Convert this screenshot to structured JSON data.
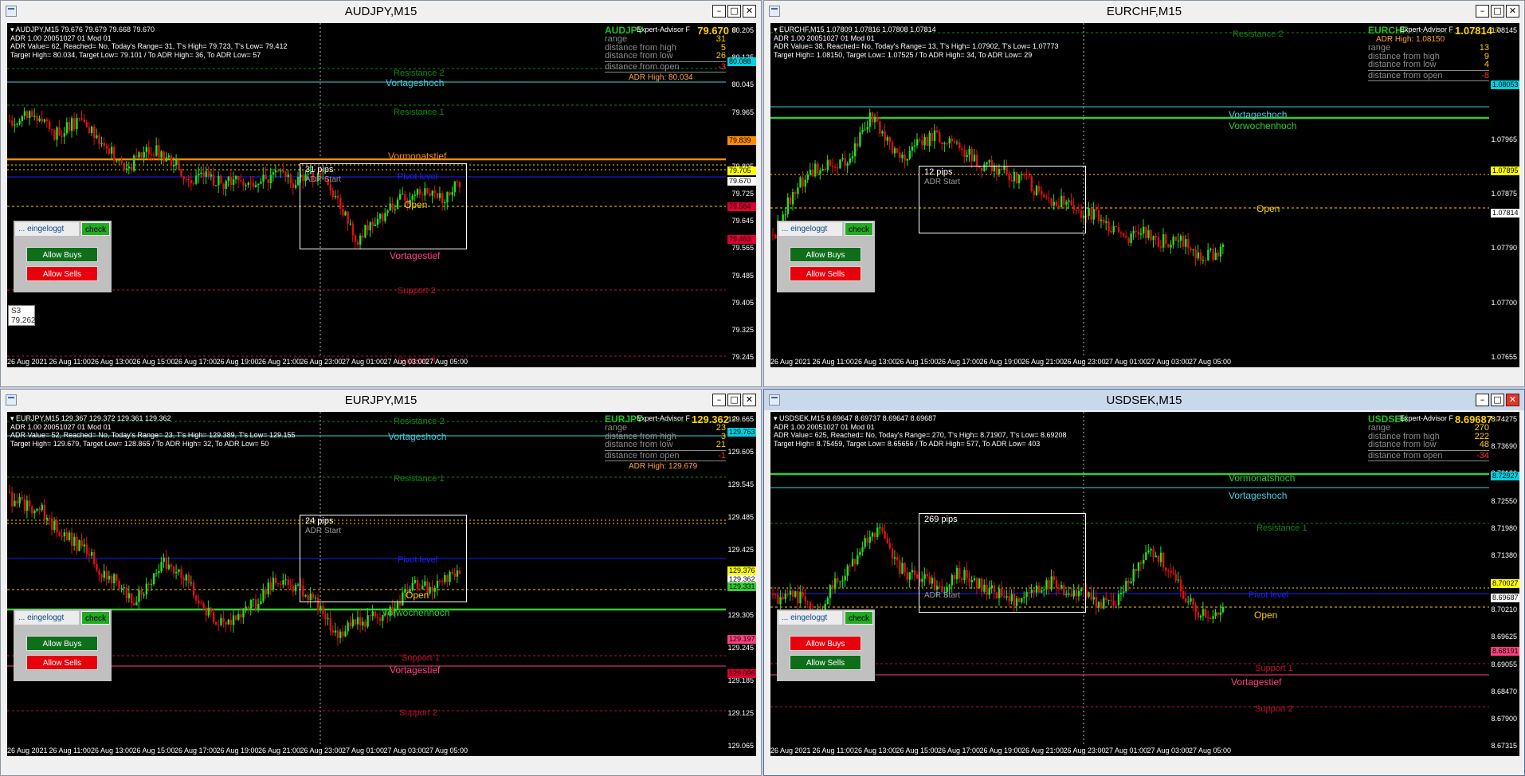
{
  "tooltip": {
    "line1": "S3",
    "line2": "79.262"
  },
  "common": {
    "adr_line": "ADR 1.00 20051027 01 Mod 01",
    "ea_label": "Expert-Advisor F",
    "adr_start": "ADR Start",
    "login": "... eingeloggt",
    "check": "check",
    "allow_buys": "Allow Buys",
    "allow_sells": "Allow Sells",
    "xticks": [
      "26 Aug 2021",
      "26 Aug 11:00",
      "26 Aug 13:00",
      "26 Aug 15:00",
      "26 Aug 17:00",
      "26 Aug 19:00",
      "26 Aug 21:00",
      "26 Aug 23:00",
      "27 Aug 01:00",
      "27 Aug 03:00",
      "27 Aug 05:00"
    ],
    "labels": {
      "range": "range",
      "dist_high": "distance from high",
      "dist_low": "distance from low",
      "dist_open": "distance from open"
    }
  },
  "windows": [
    {
      "title": "AUDJPY,M15",
      "symbol_line": "AUDJPY,M15  79.676 79.679 79.668 79.670",
      "adr_value_line": "ADR Value= 62, Reached= No, Today's Range= 31, T's High= 79.723, T's Low= 79.412",
      "target_line": "Target High= 80.034, Target Low= 79.101 / To ADR High= 36, To ADR Low= 57",
      "symbol": "AUDJPY",
      "price": "79.670",
      "panel": {
        "range": "31",
        "dist_high": "5",
        "dist_low": "26",
        "dist_open": "-3",
        "adr_line": "ADR High: 80.034"
      },
      "pips": "31 pips",
      "yticks": [
        "80.205",
        "80.125",
        "80.045",
        "79.965",
        "79.885",
        "79.805",
        "79.725",
        "79.645",
        "79.565",
        "79.485",
        "79.405",
        "79.325",
        "79.245"
      ],
      "price_labels": [
        {
          "text": "80.088",
          "color": "#00d0e0"
        },
        {
          "text": "79.839",
          "color": "#ff8c00"
        },
        {
          "text": "79.705",
          "color": "#ffff00"
        },
        {
          "text": "79.670",
          "color": "#ffffff"
        },
        {
          "text": "79.564",
          "color": "#e00030"
        },
        {
          "text": "79.463",
          "color": "#e00030"
        }
      ],
      "levels": [
        {
          "text": "Resistance 2",
          "color": "#118811"
        },
        {
          "text": "Vortageshoch",
          "color": "#40d0e0"
        },
        {
          "text": "Resistance 1",
          "color": "#118811"
        },
        {
          "text": "Vormonatstief",
          "color": "#ff8c00"
        },
        {
          "text": "Pivot level",
          "color": "#2020ff"
        },
        {
          "text": "Open",
          "color": "#ffd000"
        },
        {
          "text": "Vortagestief",
          "color": "#ff4080"
        },
        {
          "text": "Support 2",
          "color": "#c01030"
        },
        {
          "text": "Support 3",
          "color": "#c01030"
        }
      ]
    },
    {
      "title": "EURCHF,M15",
      "symbol_line": "EURCHF,M15  1.07809 1.07816 1.07808 1.07814",
      "adr_value_line": "ADR Value= 38, Reached= No, Today's Range= 13, T's High= 1.07902, T's Low= 1.07773",
      "target_line": "Target High= 1.08150, Target Low= 1.07525 / To ADR High= 34, To ADR Low= 29",
      "symbol": "EURCHF",
      "price": "1.07814",
      "panel": {
        "range": "13",
        "dist_high": "9",
        "dist_low": "4",
        "dist_open": "-8",
        "adr_line": "ADR High: 1.08150"
      },
      "pips": "12 pips",
      "yticks": [
        "1.08145",
        "1.08055",
        "1.07965",
        "1.07875",
        "1.07790",
        "1.07700",
        "1.07655"
      ],
      "price_labels": [
        {
          "text": "1.08053",
          "color": "#00d0e0"
        },
        {
          "text": "1.07895",
          "color": "#ffff00"
        },
        {
          "text": "1.07814",
          "color": "#ffffff"
        }
      ],
      "levels": [
        {
          "text": "Resistance 2",
          "color": "#118811"
        },
        {
          "text": "Vortageshoch",
          "color": "#40d0e0"
        },
        {
          "text": "Vorwochenhoch",
          "color": "#33cc33"
        },
        {
          "text": "Open",
          "color": "#ffd000"
        }
      ]
    },
    {
      "title": "EURJPY,M15",
      "symbol_line": "EURJPY,M15  129.367 129.372 129.361 129.362",
      "adr_value_line": "ADR Value= 52, Reached= No, Today's Range= 23, T's High= 129.389, T's Low= 129.155",
      "target_line": "Target High= 129.679, Target Low= 128.865 / To ADR High= 32, To ADR Low= 50",
      "symbol": "EURJPY",
      "price": "129.362",
      "panel": {
        "range": "23",
        "dist_high": "3",
        "dist_low": "21",
        "dist_open": "-1",
        "adr_line": "ADR High: 129.679"
      },
      "pips": "24 pips",
      "yticks": [
        "129.665",
        "129.605",
        "129.545",
        "129.485",
        "129.425",
        "129.365",
        "129.305",
        "129.245",
        "129.185",
        "129.125",
        "129.065"
      ],
      "price_labels": [
        {
          "text": "129.763",
          "color": "#00d0e0"
        },
        {
          "text": "129.376",
          "color": "#ffff00"
        },
        {
          "text": "129.362",
          "color": "#ffffff"
        },
        {
          "text": "129.331",
          "color": "#33cc33"
        },
        {
          "text": "129.197",
          "color": "#ff4080"
        },
        {
          "text": "129.096",
          "color": "#e00030"
        }
      ],
      "levels": [
        {
          "text": "Resistance 2",
          "color": "#118811"
        },
        {
          "text": "Vortageshoch",
          "color": "#40d0e0"
        },
        {
          "text": "Resistance 1",
          "color": "#118811"
        },
        {
          "text": "Pivot level",
          "color": "#2020ff"
        },
        {
          "text": "Open",
          "color": "#ffd000"
        },
        {
          "text": "Vorwochenhoch",
          "color": "#33cc33"
        },
        {
          "text": "Support 1",
          "color": "#c01030"
        },
        {
          "text": "Vortagestief",
          "color": "#ff4080"
        },
        {
          "text": "Support 2",
          "color": "#c01030"
        }
      ]
    },
    {
      "title": "USDSEK,M15",
      "symbol_line": "USDSEK,M15  8.69647 8.69737 8.69647 8.69687",
      "adr_value_line": "ADR Value= 625, Reached= No, Today's Range= 270, T's High= 8.71907, T's Low= 8.69208",
      "target_line": "Target High= 8.75459, Target Low= 8.65656 / To ADR High= 577, To ADR Low= 403",
      "symbol": "USDSEK",
      "price": "8.69687",
      "panel": {
        "range": "270",
        "dist_high": "222",
        "dist_low": "48",
        "dist_open": "-34",
        "adr_line": ""
      },
      "pips": "269 pips",
      "yticks": [
        "8.74275",
        "8.73690",
        "8.73120",
        "8.72550",
        "8.71980",
        "8.71380",
        "8.70795",
        "8.70210",
        "8.69625",
        "8.69055",
        "8.68470",
        "8.67900",
        "8.67315"
      ],
      "price_labels": [
        {
          "text": "8.72927",
          "color": "#00d0e0"
        },
        {
          "text": "8.70027",
          "color": "#ffff00"
        },
        {
          "text": "8.69687",
          "color": "#ffffff"
        },
        {
          "text": "8.68191",
          "color": "#ff4080"
        }
      ],
      "levels": [
        {
          "text": "Vormonatshoch",
          "color": "#33cc33"
        },
        {
          "text": "Vortageshoch",
          "color": "#40d0e0"
        },
        {
          "text": "Resistance 1",
          "color": "#118811"
        },
        {
          "text": "Pivot level",
          "color": "#2020ff"
        },
        {
          "text": "Open",
          "color": "#ffd000"
        },
        {
          "text": "Support 1",
          "color": "#c01030"
        },
        {
          "text": "Vortagestief",
          "color": "#ff4080"
        },
        {
          "text": "Support 2",
          "color": "#c01030"
        }
      ]
    }
  ]
}
